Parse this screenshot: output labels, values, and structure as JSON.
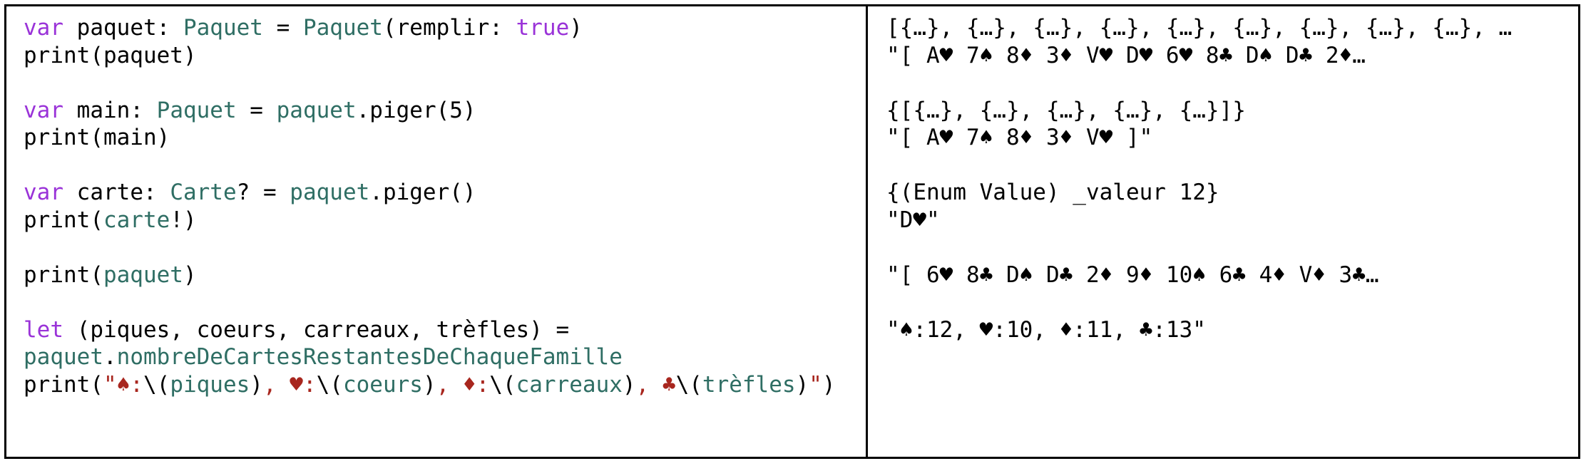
{
  "colors": {
    "keyword": "#9a33d8",
    "type": "#2f6e64",
    "string": "#a8261e",
    "plain": "#000000",
    "border": "#000000"
  },
  "code_lines": [
    [
      [
        "kw",
        "var"
      ],
      [
        "p",
        " paquet: "
      ],
      [
        "ty",
        "Paquet"
      ],
      [
        "p",
        " = "
      ],
      [
        "ty",
        "Paquet"
      ],
      [
        "p",
        "(remplir: "
      ],
      [
        "kw",
        "true"
      ],
      [
        "p",
        ")"
      ]
    ],
    [
      [
        "p",
        "print(paquet)"
      ]
    ],
    [],
    [
      [
        "kw",
        "var"
      ],
      [
        "p",
        " main: "
      ],
      [
        "ty",
        "Paquet"
      ],
      [
        "p",
        " = "
      ],
      [
        "ty",
        "paquet"
      ],
      [
        "p",
        ".piger(5)"
      ]
    ],
    [
      [
        "p",
        "print(main)"
      ]
    ],
    [],
    [
      [
        "kw",
        "var"
      ],
      [
        "p",
        " carte: "
      ],
      [
        "ty",
        "Carte"
      ],
      [
        "p",
        "? = "
      ],
      [
        "ty",
        "paquet"
      ],
      [
        "p",
        ".piger()"
      ]
    ],
    [
      [
        "p",
        "print("
      ],
      [
        "ty",
        "carte"
      ],
      [
        "p",
        "!)"
      ]
    ],
    [],
    [
      [
        "p",
        "print("
      ],
      [
        "ty",
        "paquet"
      ],
      [
        "p",
        ")"
      ]
    ],
    [],
    [
      [
        "kw",
        "let"
      ],
      [
        "p",
        " (piques, coeurs, carreaux, trèfles) ="
      ]
    ],
    [
      [
        "ty",
        "paquet"
      ],
      [
        "p",
        "."
      ],
      [
        "ty",
        "nombreDeCartesRestantesDeChaqueFamille"
      ]
    ],
    [
      [
        "p",
        "print("
      ],
      [
        "str",
        "\"♠:"
      ],
      [
        "p",
        "\\("
      ],
      [
        "ty",
        "piques"
      ],
      [
        "p",
        ")"
      ],
      [
        "str",
        ", ♥:"
      ],
      [
        "p",
        "\\("
      ],
      [
        "ty",
        "coeurs"
      ],
      [
        "p",
        ")"
      ],
      [
        "str",
        ", ♦:"
      ],
      [
        "p",
        "\\("
      ],
      [
        "ty",
        "carreaux"
      ],
      [
        "p",
        ")"
      ],
      [
        "str",
        ", ♣"
      ],
      [
        "p",
        "\\("
      ],
      [
        "ty",
        "trèfles"
      ],
      [
        "p",
        ")"
      ],
      [
        "str",
        "\""
      ],
      [
        "p",
        ")"
      ]
    ]
  ],
  "output_lines": [
    "[{…}, {…}, {…}, {…}, {…}, {…}, {…}, {…}, {…}, …",
    "\"[ A♥ 7♠ 8♦ 3♦ V♥ D♥ 6♥ 8♣ D♠ D♣ 2♦…",
    "",
    "{[{…}, {…}, {…}, {…}, {…}]}",
    "\"[ A♥ 7♠ 8♦ 3♦ V♥ ]\"",
    "",
    "{(Enum Value) _valeur 12}",
    "\"D♥\"",
    "",
    "\"[ 6♥ 8♣ D♠ D♣ 2♦ 9♦ 10♠ 6♣ 4♦ V♦ 3♣…",
    "",
    "\"♠:12, ♥:10, ♦:11, ♣:13\""
  ]
}
